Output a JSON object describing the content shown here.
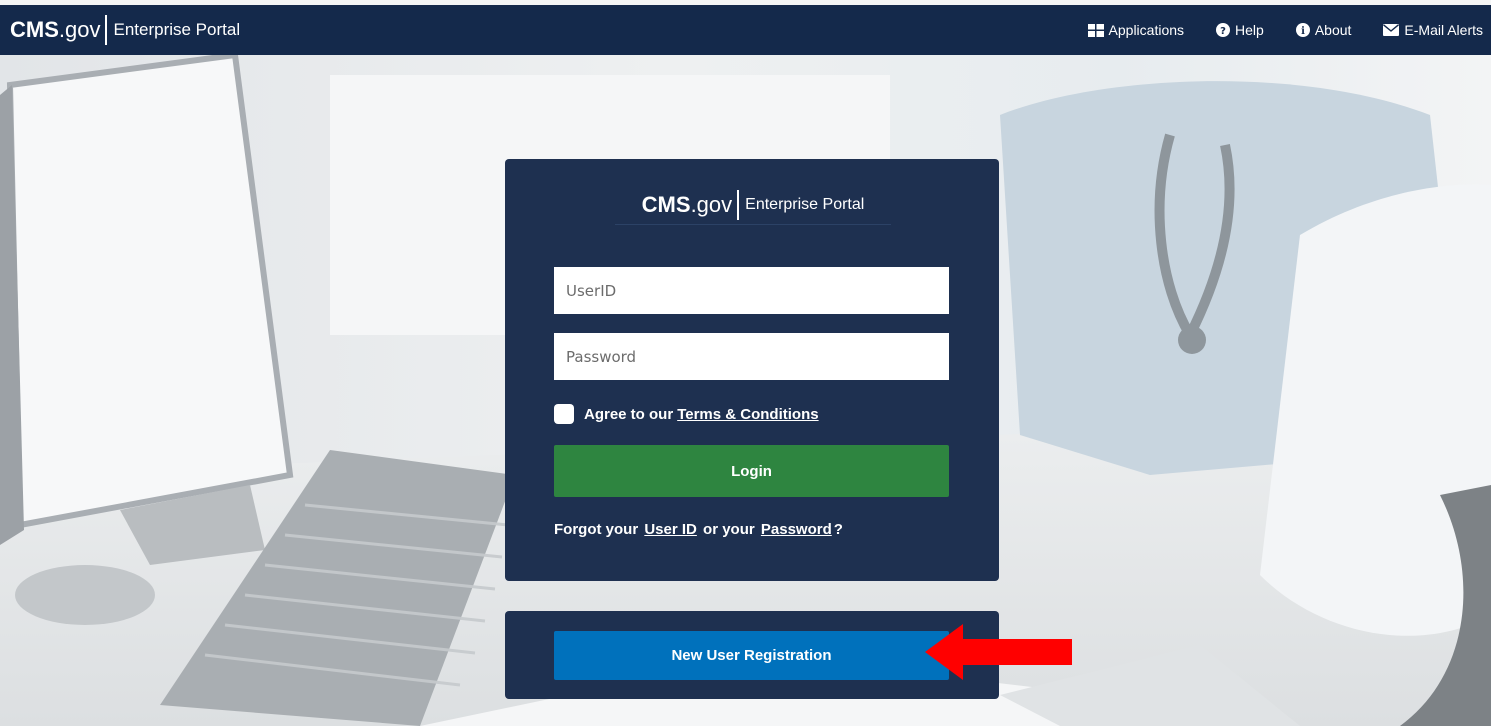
{
  "header": {
    "logo": {
      "cms": "CMS",
      "gov": ".gov",
      "portal": "Enterprise Portal"
    },
    "nav": [
      {
        "label": "Applications",
        "icon": "grid-icon"
      },
      {
        "label": "Help",
        "icon": "question-circle-icon"
      },
      {
        "label": "About",
        "icon": "info-circle-icon"
      },
      {
        "label": "E-Mail Alerts",
        "icon": "envelope-icon"
      }
    ]
  },
  "login": {
    "logo": {
      "cms": "CMS",
      "gov": ".gov",
      "portal": "Enterprise Portal"
    },
    "userid_placeholder": "UserID",
    "password_placeholder": "Password",
    "agree_text": "Agree to our",
    "terms_link": "Terms & Conditions",
    "login_button": "Login",
    "forgot_prefix": "Forgot your",
    "forgot_userid": "User ID",
    "forgot_middle": "or your",
    "forgot_password": "Password",
    "forgot_suffix": "?"
  },
  "registration": {
    "button": "New User Registration"
  },
  "colors": {
    "header_bg": "#14294b",
    "card_bg": "#1e3050",
    "login_green": "#2e8540",
    "register_blue": "#0071bc",
    "annotation_arrow": "#ff0000"
  }
}
